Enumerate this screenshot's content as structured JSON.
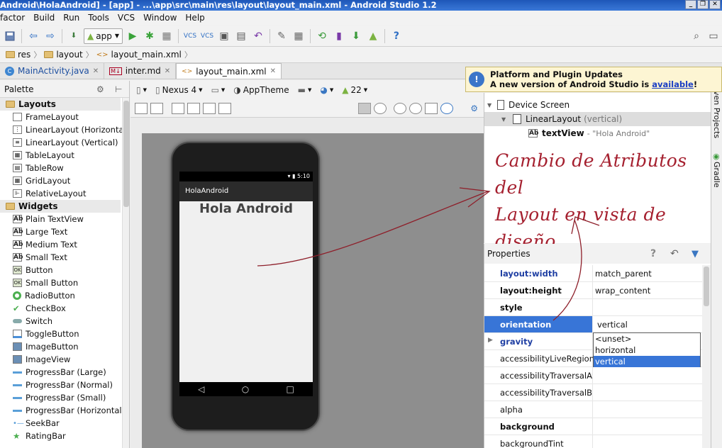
{
  "window": {
    "title": "Android\\HolaAndroid] - [app] - ...\\app\\src\\main\\res\\layout\\layout_main.xml - Android Studio 1.2",
    "buttons": [
      "_",
      "❐",
      "✕"
    ]
  },
  "menu": [
    "factor",
    "Build",
    "Run",
    "Tools",
    "VCS",
    "Window",
    "Help"
  ],
  "toolbar": {
    "app_label": "app"
  },
  "breadcrumbs": [
    "res",
    "layout",
    "layout_main.xml"
  ],
  "tabs": [
    {
      "label": "MainActivity.java",
      "icon": "C"
    },
    {
      "label": "inter.md",
      "icon": "M↓"
    },
    {
      "label": "layout_main.xml",
      "icon": "<>"
    }
  ],
  "palette": {
    "title": "Palette",
    "sections": [
      {
        "name": "Layouts",
        "items": [
          "FrameLayout",
          "LinearLayout (Horizontal)",
          "LinearLayout (Vertical)",
          "TableLayout",
          "TableRow",
          "GridLayout",
          "RelativeLayout"
        ]
      },
      {
        "name": "Widgets",
        "items": [
          "Plain TextView",
          "Large Text",
          "Medium Text",
          "Small Text",
          "Button",
          "Small Button",
          "RadioButton",
          "CheckBox",
          "Switch",
          "ToggleButton",
          "ImageButton",
          "ImageView",
          "ProgressBar (Large)",
          "ProgressBar (Normal)",
          "ProgressBar (Small)",
          "ProgressBar (Horizontal)",
          "SeekBar",
          "RatingBar"
        ]
      }
    ]
  },
  "design_toolbar": {
    "device": "Nexus 4",
    "theme": "AppTheme",
    "api": "22"
  },
  "phone": {
    "status_time": "5:10",
    "app_title": "HolaAndroid",
    "text": "Hola Android",
    "nav": [
      "◁",
      "○",
      "□"
    ]
  },
  "updates": {
    "title": "Platform and Plugin Updates",
    "message": "A new version of Android Studio is ",
    "link": "available",
    "suffix": "!"
  },
  "component_tree": {
    "root": "Device Screen",
    "layout": "LinearLayout",
    "layout_hint": "(vertical)",
    "child": "textView",
    "child_hint": "- \"Hola Android\""
  },
  "annotation": [
    "Cambio de Atributos del",
    "Layout en vista de",
    "diseño"
  ],
  "properties": {
    "title": "Properties",
    "rows": [
      {
        "name": "layout:width",
        "value": "match_parent",
        "style": "blue"
      },
      {
        "name": "layout:height",
        "value": "wrap_content",
        "style": "bold"
      },
      {
        "name": "style",
        "value": "",
        "style": "bold"
      },
      {
        "name": "orientation",
        "value": "vertical",
        "style": "sel"
      },
      {
        "name": "gravity",
        "value": "",
        "style": "blue"
      },
      {
        "name": "accessibilityLiveRegion",
        "value": "",
        "style": ""
      },
      {
        "name": "accessibilityTraversalAfter",
        "value": "",
        "style": ""
      },
      {
        "name": "accessibilityTraversalBefore",
        "value": "",
        "style": ""
      },
      {
        "name": "alpha",
        "value": "",
        "style": ""
      },
      {
        "name": "background",
        "value": "",
        "style": "bold"
      },
      {
        "name": "backgroundTint",
        "value": "",
        "style": ""
      }
    ],
    "dropdown": [
      "<unset>",
      "horizontal",
      "vertical"
    ]
  },
  "right_strip": [
    "ven Projects",
    "Gradle"
  ],
  "colors": {
    "accent": "#3875d7",
    "annotation": "#a5202f",
    "titlebar": "#1e57b8"
  }
}
